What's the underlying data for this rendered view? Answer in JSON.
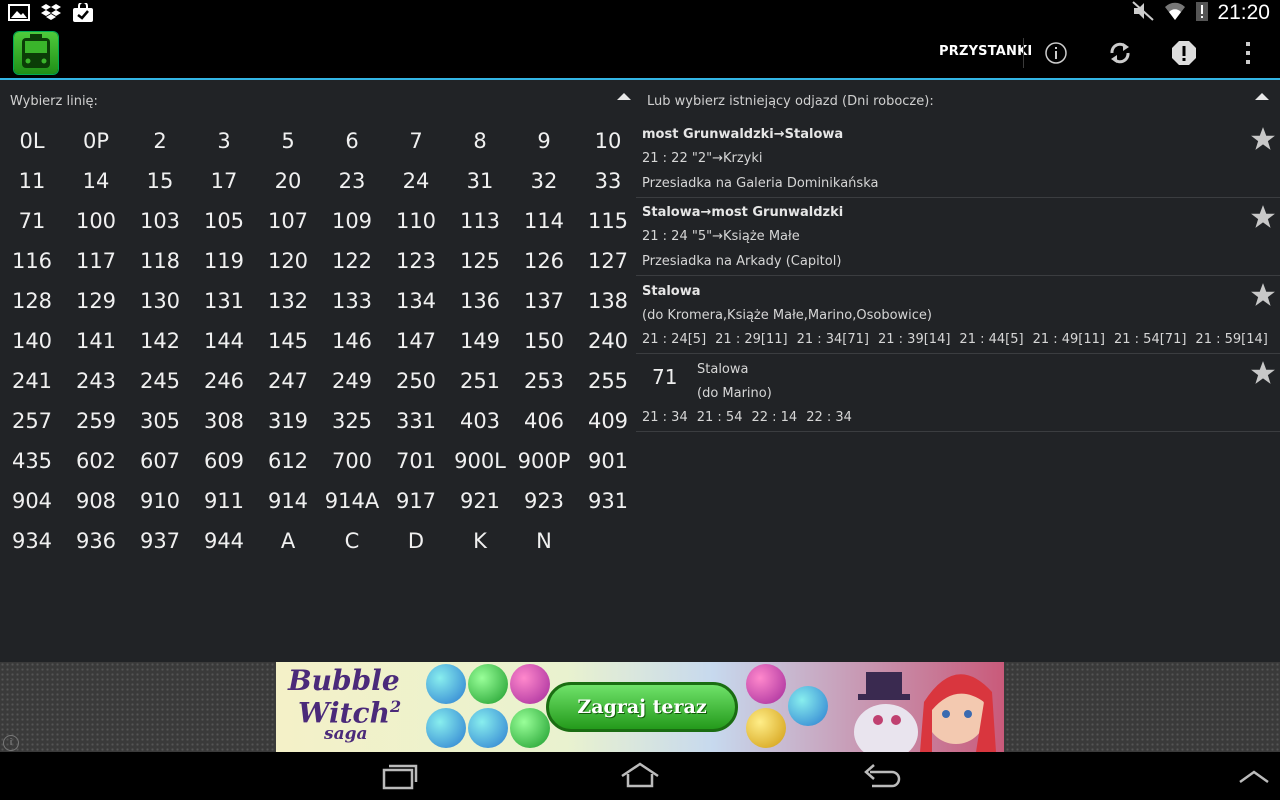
{
  "status": {
    "time": "21:20"
  },
  "actionbar": {
    "stops_label": "PRZYSTANKI"
  },
  "left": {
    "label": "Wybierz linię:",
    "lines": [
      "0L",
      "0P",
      "2",
      "3",
      "5",
      "6",
      "7",
      "8",
      "9",
      "10",
      "11",
      "14",
      "15",
      "17",
      "20",
      "23",
      "24",
      "31",
      "32",
      "33",
      "71",
      "100",
      "103",
      "105",
      "107",
      "109",
      "110",
      "113",
      "114",
      "115",
      "116",
      "117",
      "118",
      "119",
      "120",
      "122",
      "123",
      "125",
      "126",
      "127",
      "128",
      "129",
      "130",
      "131",
      "132",
      "133",
      "134",
      "136",
      "137",
      "138",
      "140",
      "141",
      "142",
      "144",
      "145",
      "146",
      "147",
      "149",
      "150",
      "240",
      "241",
      "243",
      "245",
      "246",
      "247",
      "249",
      "250",
      "251",
      "253",
      "255",
      "257",
      "259",
      "305",
      "308",
      "319",
      "325",
      "331",
      "403",
      "406",
      "409",
      "435",
      "602",
      "607",
      "609",
      "612",
      "700",
      "701",
      "900L",
      "900P",
      "901",
      "904",
      "908",
      "910",
      "911",
      "914",
      "914A",
      "917",
      "921",
      "923",
      "931",
      "934",
      "936",
      "937",
      "944",
      "A",
      "C",
      "D",
      "K",
      "N"
    ]
  },
  "right": {
    "label": "Lub wybierz istniejący odjazd (Dni robocze):",
    "departures": [
      {
        "route": "most Grunwaldzki→Stalowa",
        "detail": "21 : 22 \"2\"→Krzyki",
        "transfer": "Przesiadka na Galeria Dominikańska"
      },
      {
        "route": "Stalowa→most Grunwaldzki",
        "detail": "21 : 24 \"5\"→Książe Małe",
        "transfer": "Przesiadka na Arkady (Capitol)"
      },
      {
        "route": "Stalowa",
        "detail": "(do Kromera,Książe Małe,Marino,Osobowice)",
        "times": [
          "21 : 24[5]",
          "21 : 29[11]",
          "21 : 34[71]",
          "21 : 39[14]",
          "21 : 44[5]",
          "21 : 49[11]",
          "21 : 54[71]",
          "21 : 59[14]"
        ]
      },
      {
        "line": "71",
        "stop": "Stalowa",
        "direction": "(do Marino)",
        "times": [
          "21 : 34",
          "21 : 54",
          "22 : 14",
          "22 : 34"
        ]
      }
    ]
  },
  "ad": {
    "brand_line1": "Bubble",
    "brand_line2": "Witch",
    "brand_sup": "2",
    "brand_line3": "saga",
    "cta": "Zagraj teraz",
    "info": "i"
  }
}
